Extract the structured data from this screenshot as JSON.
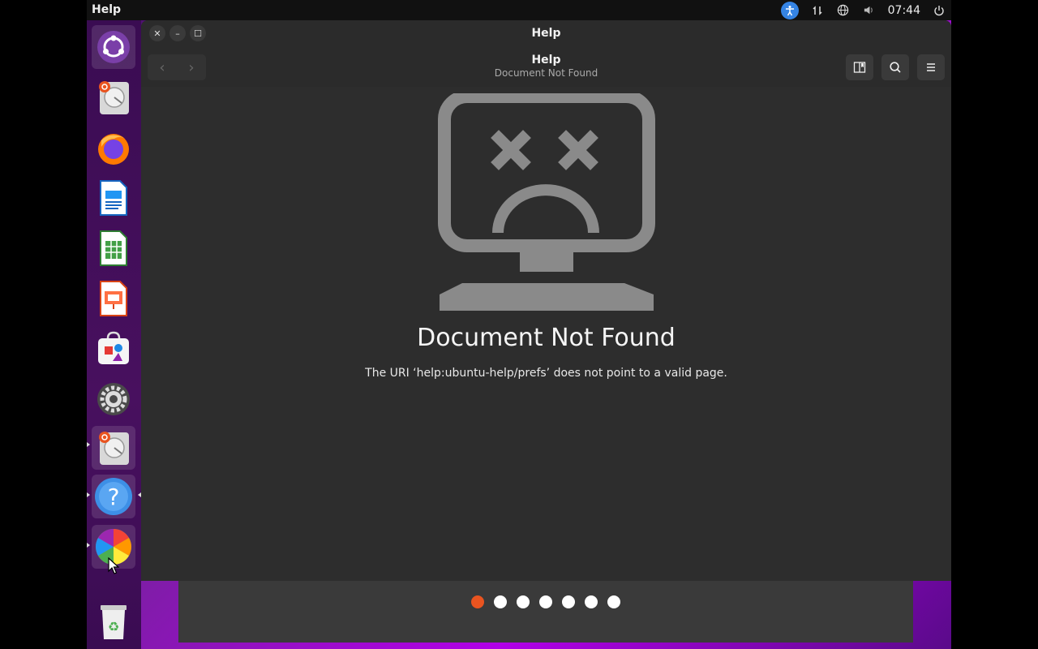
{
  "topbar": {
    "app_name": "Help",
    "clock": "07:44",
    "icons": [
      "accessibility-icon",
      "network-icon",
      "globe-icon",
      "volume-icon",
      "power-icon"
    ]
  },
  "dock": {
    "items": [
      {
        "name": "ubuntu-logo-icon"
      },
      {
        "name": "disk-usage-icon"
      },
      {
        "name": "firefox-icon"
      },
      {
        "name": "writer-icon"
      },
      {
        "name": "calc-icon"
      },
      {
        "name": "impress-icon"
      },
      {
        "name": "app-center-icon"
      },
      {
        "name": "settings-icon"
      },
      {
        "name": "disk-usage-icon"
      },
      {
        "name": "help-icon"
      },
      {
        "name": "color-icon"
      },
      {
        "name": "trash-icon"
      }
    ]
  },
  "window": {
    "title": "Help",
    "header_title": "Help",
    "header_subtitle": "Document Not Found",
    "error_heading": "Document Not Found",
    "error_message": "The URI ‘help:ubuntu-help/prefs’ does not point to a valid page."
  },
  "loader": {
    "dots_total": 7,
    "active_index": 0
  },
  "colors": {
    "accent": "#e95420",
    "dock_bg": "#48105f",
    "window_bg": "#2d2d2d"
  }
}
